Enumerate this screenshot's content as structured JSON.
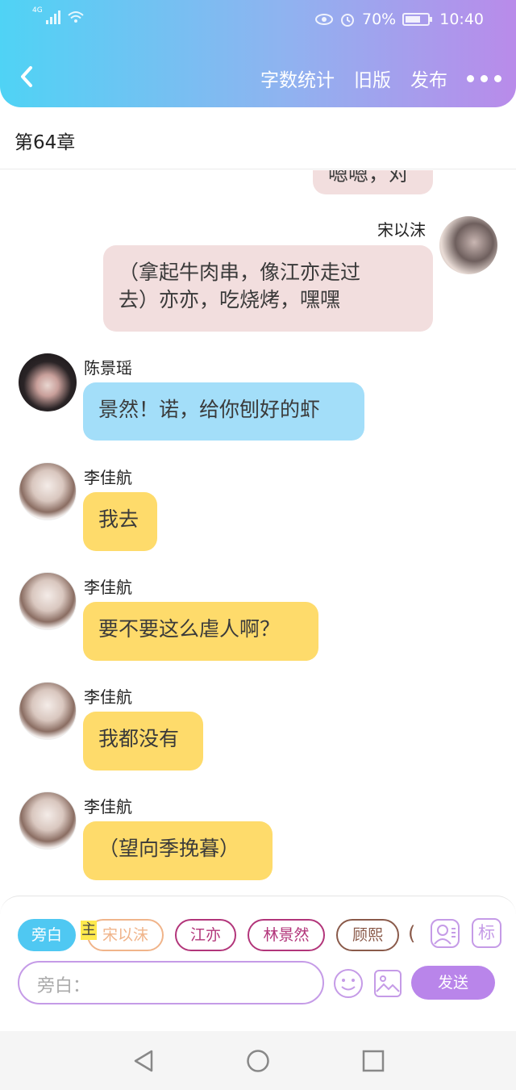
{
  "status_bar": {
    "network": "4G",
    "battery_percent": "70%",
    "battery_level": 0.7,
    "time": "10:40"
  },
  "nav": {
    "word_count": "字数统计",
    "old_version": "旧版",
    "publish": "发布"
  },
  "chapter": {
    "title": "第64章"
  },
  "messages": [
    {
      "side": "right",
      "speaker": "",
      "text": "嗯嗯，对",
      "color": "#f2dede"
    },
    {
      "side": "right",
      "speaker": "宋以沫",
      "text": "（拿起牛肉串，像江亦走过去）亦亦，吃烧烤，嘿嘿",
      "line1": "（拿起牛肉串，像江亦走过",
      "line2": "去）亦亦，吃烧烤，嘿嘿",
      "color": "#f2dede"
    },
    {
      "side": "left",
      "speaker": "陈景瑶",
      "text": "景然！诺，给你刨好的虾",
      "color": "#a3def9"
    },
    {
      "side": "left",
      "speaker": "李佳航",
      "text": "我去",
      "color": "#fedb6b"
    },
    {
      "side": "left",
      "speaker": "李佳航",
      "text": "要不要这么虐人啊？",
      "color": "#fedb6b"
    },
    {
      "side": "left",
      "speaker": "李佳航",
      "text": "我都没有",
      "color": "#fedb6b"
    },
    {
      "side": "left",
      "speaker": "李佳航",
      "text": "（望向季挽暮）",
      "color": "#fedb6b"
    }
  ],
  "role_bar": {
    "chips": [
      {
        "label": "旁白",
        "color": "#4fc8f2"
      },
      {
        "label": "宋以沫",
        "color": "#f0b48a"
      },
      {
        "label": "江亦",
        "color": "#b2357a"
      },
      {
        "label": "林景然",
        "color": "#b2357a"
      },
      {
        "label": "顾熙",
        "color": "#8a5a4a"
      }
    ],
    "main_tag": "主",
    "partial_chip": "(",
    "mark_label": "标"
  },
  "input": {
    "placeholder": "旁白：",
    "send": "发送"
  },
  "colors": {
    "header_start": "#4fd3f5",
    "header_end": "#b98bea",
    "accent": "#b985ea"
  }
}
